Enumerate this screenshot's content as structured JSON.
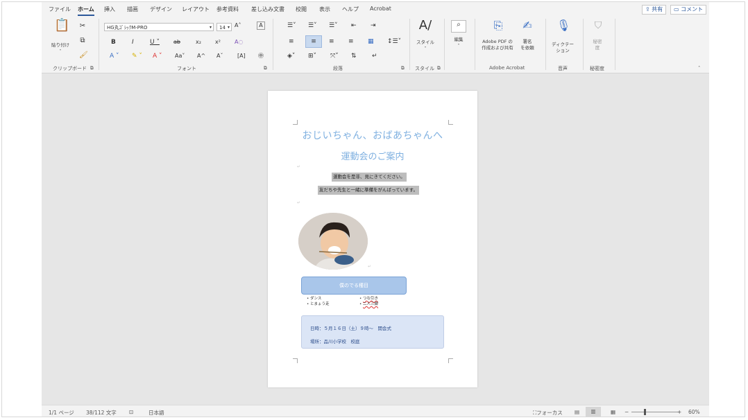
{
  "ribbon_tabs": [
    "ファイル",
    "ホーム",
    "挿入",
    "描画",
    "デザイン",
    "レイアウト",
    "参考資料",
    "差し込み文書",
    "校閲",
    "表示",
    "ヘルプ",
    "Acrobat"
  ],
  "active_tab": "ホーム",
  "top_buttons": {
    "share": "共有",
    "comment": "コメント"
  },
  "clipboard": {
    "paste_label": "貼り付け",
    "group_label": "クリップボード"
  },
  "font": {
    "font_name": "HG丸ｺﾞｼｯｸM-PRO",
    "font_size": "14",
    "group_label": "フォント"
  },
  "paragraph": {
    "group_label": "段落"
  },
  "styles": {
    "styles_label": "スタイル",
    "group_label": "スタイル"
  },
  "editing": {
    "label": "編集"
  },
  "acrobat": {
    "create_share_label_1": "Adobe PDF の",
    "create_share_label_2": "作成および共有",
    "sign_label_1": "署名",
    "sign_label_2": "を依頼",
    "group_label": "Adobe Acrobat"
  },
  "voice": {
    "dictate_label_1": "ディクテー",
    "dictate_label_2": "ション",
    "group_label": "音声"
  },
  "sensitivity": {
    "label_1": "秘密",
    "label_2": "度",
    "group_label": "秘密度"
  },
  "document": {
    "title_line1": "おじいちゃん、おばあちゃんへ",
    "title_line2": "運動会のご案内",
    "sel_line1": "運動会を是非、見にきてください。",
    "sel_line2": "友だちや先生と一緒に準備をがんばっています。",
    "button_text": "僕のでる種目",
    "bullets_left": [
      "ダンス",
      "とまょう走"
    ],
    "bullets_right": [
      "つな引き",
      "二人三脚"
    ],
    "info_line1": "日時：５月１６日（土）９時～　開会式",
    "info_line2": "場所：品川小学校　校庭"
  },
  "status": {
    "page": "1/1 ページ",
    "words": "38/112 文字",
    "language": "日本語",
    "focus": "フォーカス",
    "zoom": "60%"
  },
  "colors": {
    "accent": "#2b579a",
    "title": "#7fb0e0",
    "button": "#a9c6ea",
    "infobox": "#dbe5f6"
  }
}
